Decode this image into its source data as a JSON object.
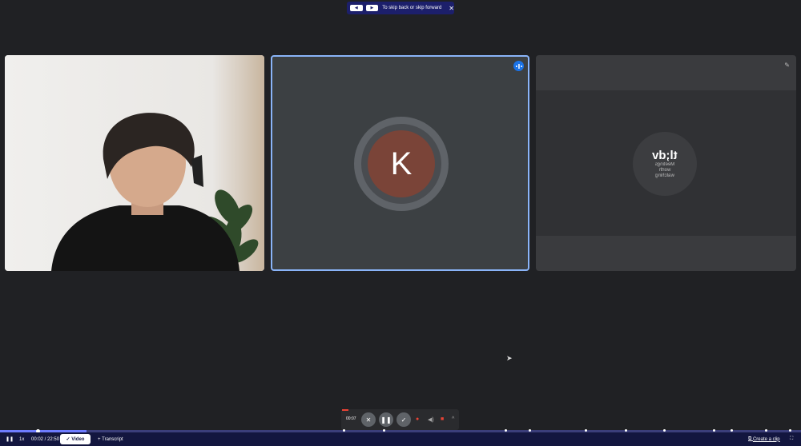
{
  "hint": {
    "text": "To skip back or skip forward",
    "left_key": "◀",
    "right_key": "▶",
    "close": "✕"
  },
  "tiles": {
    "participant2": {
      "initial": "K"
    },
    "participant3": {
      "logo": "tl;dv",
      "tagline": "Meetings worth watching"
    }
  },
  "meet_controls": {
    "time": "00:07"
  },
  "player": {
    "time": "00:02 / 22:50",
    "speed": "1x",
    "tabs": [
      {
        "label": "Video"
      },
      {
        "label": "Transcript"
      }
    ],
    "create_clip": "Create a clip",
    "progress": 0.108
  },
  "colors": {
    "accent": "#1a73e8",
    "bar": "#13163f",
    "speaker_border": "#8ab4f8"
  }
}
